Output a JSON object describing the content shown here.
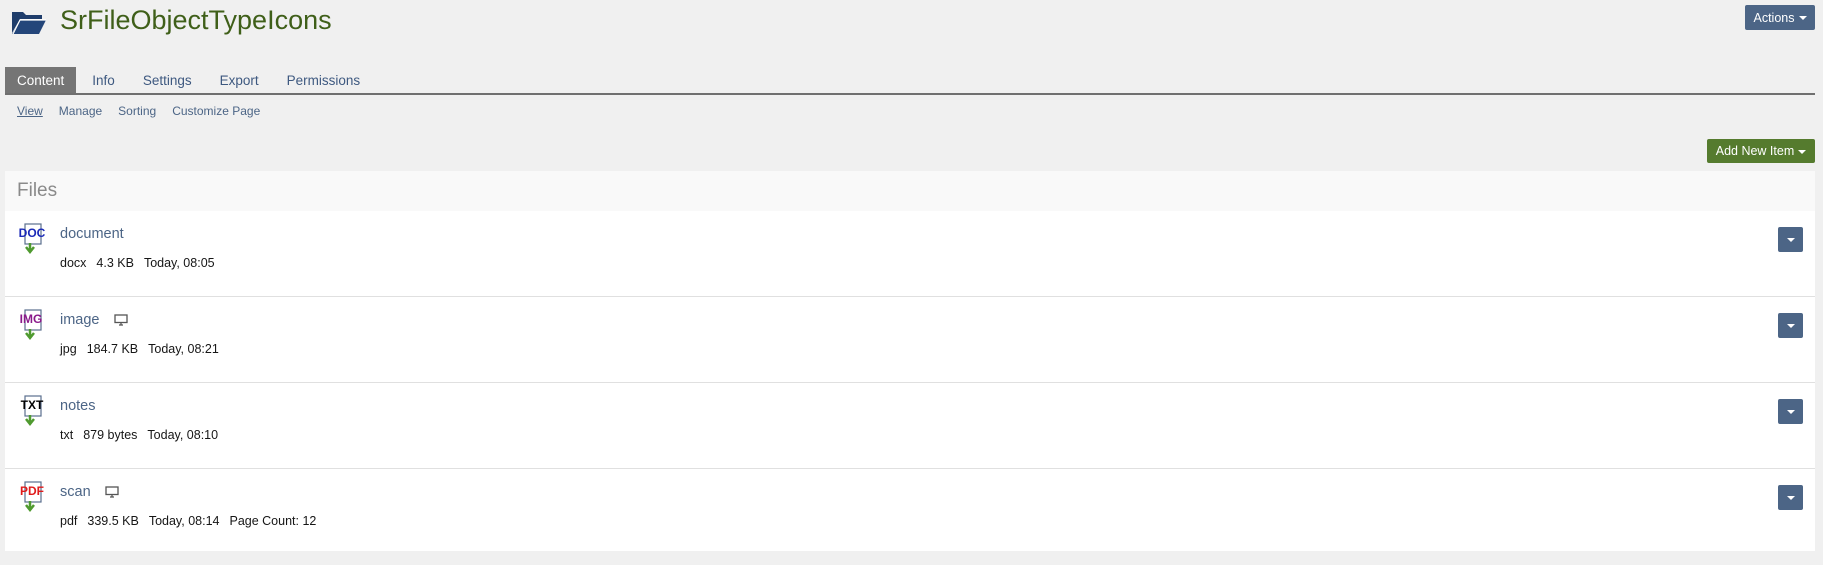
{
  "header": {
    "title": "SrFileObjectTypeIcons",
    "actions_label": "Actions",
    "title_color": "#3f5f19"
  },
  "tabs": [
    {
      "label": "Content",
      "active": true
    },
    {
      "label": "Info",
      "active": false
    },
    {
      "label": "Settings",
      "active": false
    },
    {
      "label": "Export",
      "active": false
    },
    {
      "label": "Permissions",
      "active": false
    }
  ],
  "subtabs": [
    {
      "label": "View",
      "active": true
    },
    {
      "label": "Manage",
      "active": false
    },
    {
      "label": "Sorting",
      "active": false
    },
    {
      "label": "Customize Page",
      "active": false
    }
  ],
  "toolbar": {
    "add_new_label": "Add New Item"
  },
  "files_panel": {
    "heading": "Files",
    "items": [
      {
        "title": "document",
        "type_icon": "doc-file-icon",
        "icon_text": "DOC",
        "icon_color": "#1a29b8",
        "has_preview": false,
        "meta": [
          "docx",
          "4.3 KB",
          "Today, 08:05"
        ]
      },
      {
        "title": "image",
        "type_icon": "img-file-icon",
        "icon_text": "IMG",
        "icon_color": "#8a1a8a",
        "has_preview": true,
        "meta": [
          "jpg",
          "184.7 KB",
          "Today, 08:21"
        ]
      },
      {
        "title": "notes",
        "type_icon": "txt-file-icon",
        "icon_text": "TXT",
        "icon_color": "#000000",
        "has_preview": false,
        "meta": [
          "txt",
          "879 bytes",
          "Today, 08:10"
        ]
      },
      {
        "title": "scan",
        "type_icon": "pdf-file-icon",
        "icon_text": "PDF",
        "icon_color": "#e01b1b",
        "has_preview": true,
        "meta": [
          "pdf",
          "339.5 KB",
          "Today, 08:14",
          "Page Count: 12"
        ]
      }
    ]
  },
  "colors": {
    "accent_blue": "#4c6586",
    "add_green": "#557b2e",
    "download_arrow": "#4f9a2f"
  }
}
